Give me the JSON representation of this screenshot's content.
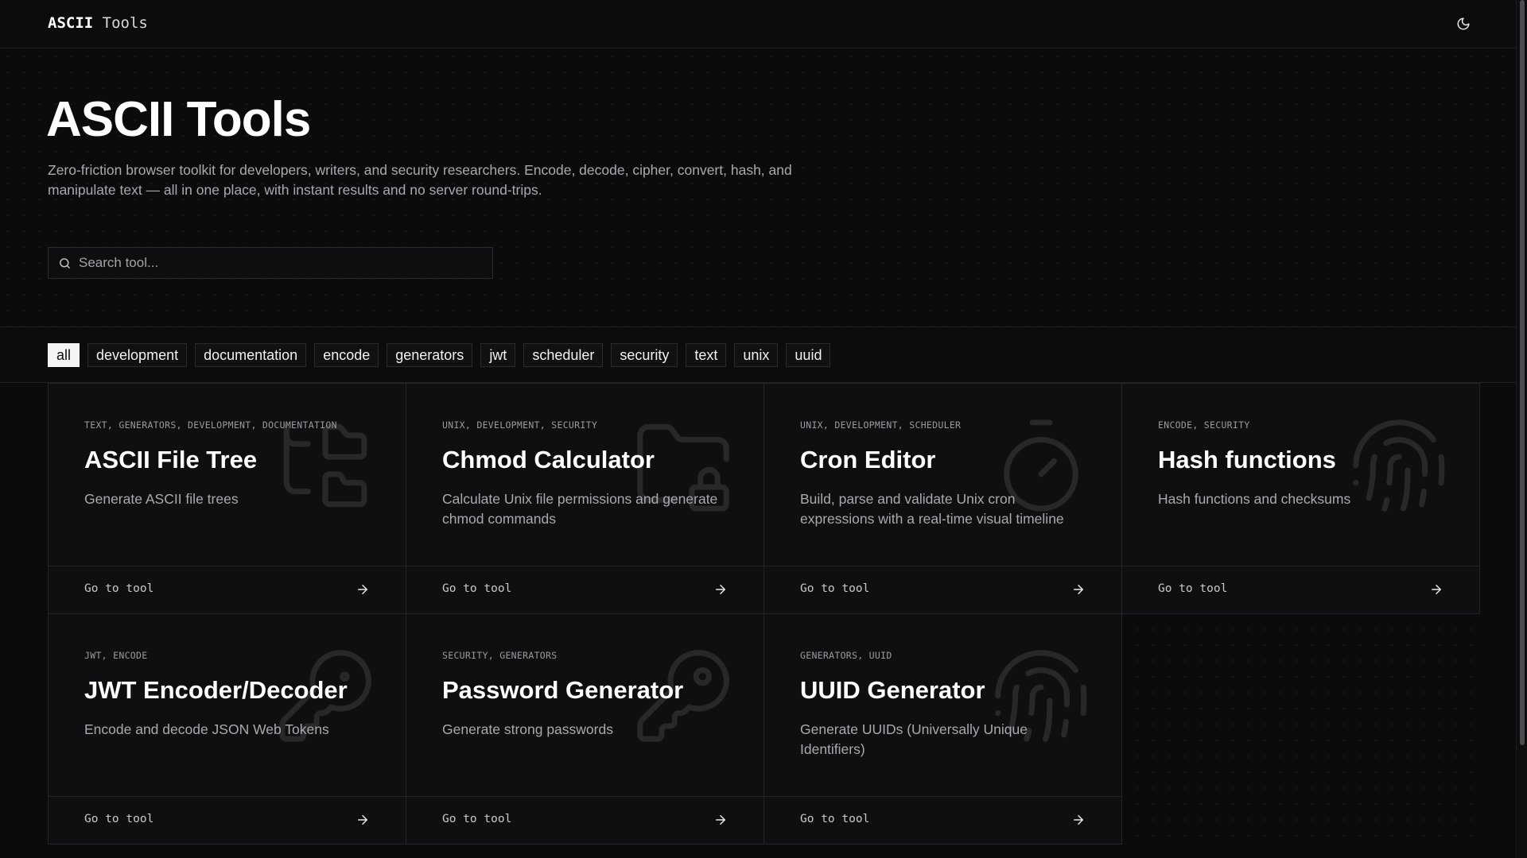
{
  "header": {
    "logo_bold": "ASCII",
    "logo_rest": " Tools",
    "theme_icon": "moon-icon"
  },
  "hero": {
    "title": "ASCII Tools",
    "description": "Zero-friction browser toolkit for developers, writers, and security researchers. Encode, decode, cipher, convert, hash, and manipulate text — all in one place, with instant results and no server round-trips.",
    "search_placeholder": "Search tool..."
  },
  "filters": {
    "active": "all",
    "tags": [
      "all",
      "development",
      "documentation",
      "encode",
      "generators",
      "jwt",
      "scheduler",
      "security",
      "text",
      "unix",
      "uuid"
    ]
  },
  "tools": [
    {
      "categories": "TEXT, GENERATORS, DEVELOPMENT, DOCUMENTATION",
      "title": "ASCII File Tree",
      "description": "Generate ASCII file trees",
      "cta": "Go to tool",
      "icon": "folder-tree-icon"
    },
    {
      "categories": "UNIX, DEVELOPMENT, SECURITY",
      "title": "Chmod Calculator",
      "description": "Calculate Unix file permissions and generate chmod commands",
      "cta": "Go to tool",
      "icon": "folder-lock-icon"
    },
    {
      "categories": "UNIX, DEVELOPMENT, SCHEDULER",
      "title": "Cron Editor",
      "description": "Build, parse and validate Unix cron expressions with a real-time visual timeline",
      "cta": "Go to tool",
      "icon": "timer-icon"
    },
    {
      "categories": "ENCODE, SECURITY",
      "title": "Hash functions",
      "description": "Hash functions and checksums",
      "cta": "Go to tool",
      "icon": "fingerprint-icon"
    },
    {
      "categories": "JWT, ENCODE",
      "title": "JWT Encoder/Decoder",
      "description": "Encode and decode JSON Web Tokens",
      "cta": "Go to tool",
      "icon": "token-key-icon"
    },
    {
      "categories": "SECURITY, GENERATORS",
      "title": "Password Generator",
      "description": "Generate strong passwords",
      "cta": "Go to tool",
      "icon": "key-icon"
    },
    {
      "categories": "GENERATORS, UUID",
      "title": "UUID Generator",
      "description": "Generate UUIDs (Universally Unique Identifiers)",
      "cta": "Go to tool",
      "icon": "fingerprint-icon"
    }
  ]
}
